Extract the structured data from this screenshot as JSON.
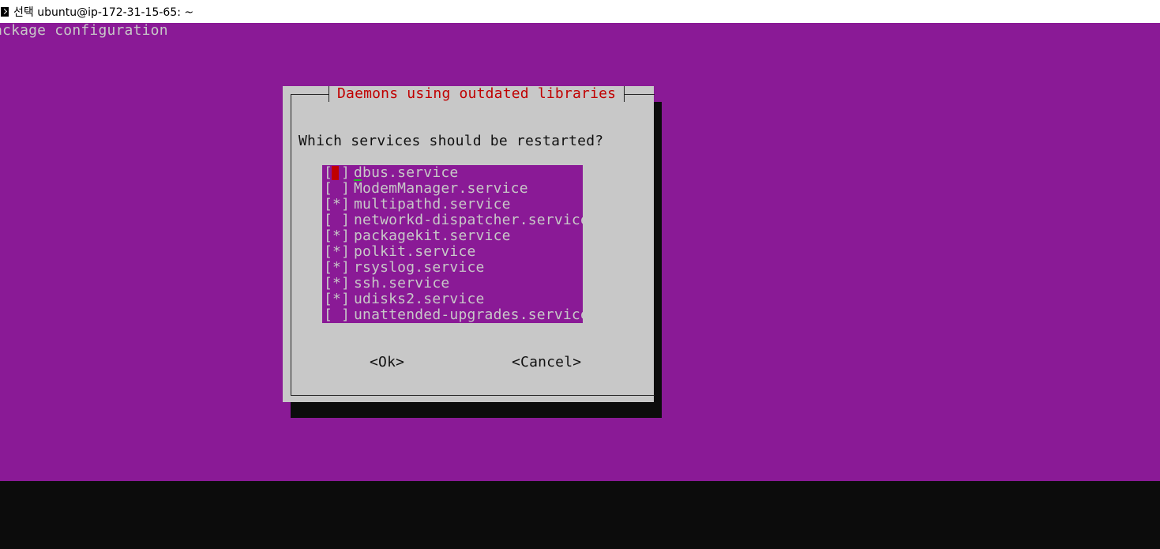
{
  "window": {
    "title": "선택 ubuntu@ip-172-31-15-65: ~"
  },
  "backtitle": "ackage configuration",
  "dialog": {
    "title": "Daemons using outdated libraries",
    "question": "Which services should be restarted?",
    "services": [
      {
        "name": "dbus.service",
        "box": "[ ]",
        "checked": false,
        "focused": true
      },
      {
        "name": "ModemManager.service",
        "box": "[ ]",
        "checked": false,
        "focused": false
      },
      {
        "name": "multipathd.service",
        "box": "[*]",
        "checked": true,
        "focused": false
      },
      {
        "name": "networkd-dispatcher.service",
        "box": "[ ]",
        "checked": false,
        "focused": false
      },
      {
        "name": "packagekit.service",
        "box": "[*]",
        "checked": true,
        "focused": false
      },
      {
        "name": "polkit.service",
        "box": "[*]",
        "checked": true,
        "focused": false
      },
      {
        "name": "rsyslog.service",
        "box": "[*]",
        "checked": true,
        "focused": false
      },
      {
        "name": "ssh.service",
        "box": "[*]",
        "checked": true,
        "focused": false
      },
      {
        "name": "udisks2.service",
        "box": "[*]",
        "checked": true,
        "focused": false
      },
      {
        "name": "unattended-upgrades.service",
        "box": "[ ]",
        "checked": false,
        "focused": false
      }
    ],
    "ok_label": "<Ok>",
    "cancel_label": "<Cancel>"
  },
  "colors": {
    "screen_bg": "#8a1a96",
    "dialog_bg": "#c8c8c8",
    "title_fg": "#c00000",
    "cursor": "#c00000",
    "caret": "#1fbf1f",
    "shadow": "#0c0c0c"
  }
}
